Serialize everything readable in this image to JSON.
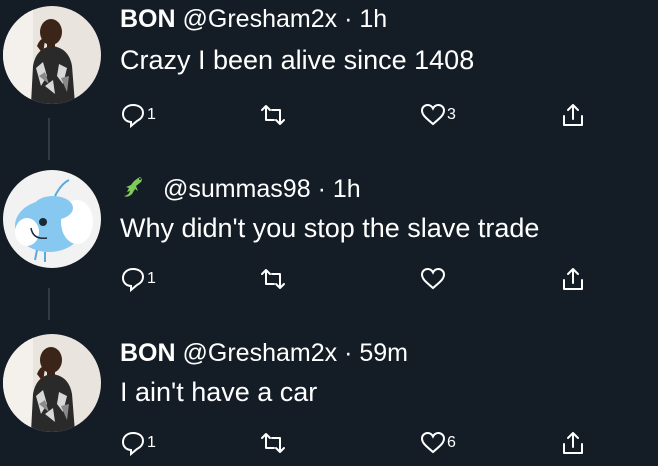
{
  "tweets": [
    {
      "name": "BON",
      "handle": "@Gresham2x",
      "sep": "·",
      "time": "1h",
      "text": "Crazy I been alive since 1408",
      "replies": "1",
      "retweets": "",
      "likes": "3",
      "avatar": "man-avatar"
    },
    {
      "name": "",
      "name_icon": "lizard-emoji-icon",
      "handle": "@summas98",
      "sep": "·",
      "time": "1h",
      "text": "Why didn't you stop the slave trade",
      "replies": "1",
      "retweets": "",
      "likes": "",
      "avatar": "cartoon-bird-avatar"
    },
    {
      "name": "BON",
      "handle": "@Gresham2x",
      "sep": "·",
      "time": "59m",
      "text": "I ain't have a car",
      "replies": "1",
      "retweets": "",
      "likes": "6",
      "avatar": "man-avatar"
    }
  ],
  "colors": {
    "background": "#141d26",
    "text": "#ffffff",
    "thread_line": "#2f3b47"
  }
}
